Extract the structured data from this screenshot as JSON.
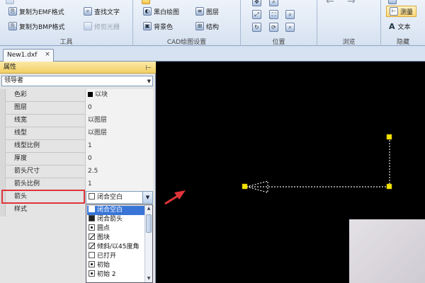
{
  "ribbon": {
    "tools_group": {
      "caption": "工具",
      "items": [
        "复制为EMF格式",
        "复制为BMP格式"
      ],
      "items2": [
        "查找文字",
        "修剪光栅"
      ]
    },
    "cad_group": {
      "caption": "CAD绘图设置",
      "items": [
        "黑白绘图",
        "背景色"
      ],
      "items2": [
        "图层",
        "结构"
      ]
    },
    "position_group": {
      "caption": "位置"
    },
    "browse_group": {
      "caption": "浏览"
    },
    "hide_group": {
      "caption": "隐藏",
      "measure_label": "测量",
      "text_label": "文本"
    }
  },
  "doc_tab": {
    "label": "New1.dxf",
    "close": "×"
  },
  "properties": {
    "header": "属性",
    "object_type": "领导者",
    "rows": [
      {
        "label": "色彩",
        "value": "以块"
      },
      {
        "label": "图层",
        "value": "0"
      },
      {
        "label": "线宽",
        "value": "以图层"
      },
      {
        "label": "线型",
        "value": "以图层"
      },
      {
        "label": "线型比例",
        "value": "1"
      },
      {
        "label": "厚度",
        "value": "0"
      },
      {
        "label": "箭头尺寸",
        "value": "2.5"
      },
      {
        "label": "箭头比例",
        "value": "1"
      },
      {
        "label": "箭头",
        "value": "闭合空白"
      },
      {
        "label": "样式",
        "value": ""
      }
    ],
    "arrow_options": [
      "闭合空白",
      "闭合箭头",
      "圆点",
      "图块",
      "倾斜/以45度角",
      "已打开",
      "初始",
      "初始 2"
    ]
  },
  "colors": {
    "selection": "#3875d7",
    "highlight_box": "#e0343a",
    "pointer_arrow": "#e0343a",
    "grip": "#f5e400",
    "canvas_bg": "#000000"
  }
}
